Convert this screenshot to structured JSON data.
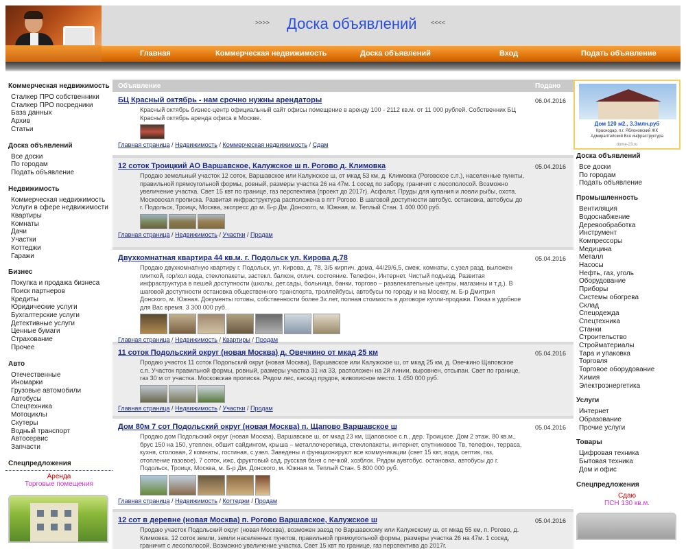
{
  "header": {
    "title": "Доска объявлений",
    "arrows_left": ">>>>",
    "arrows_right": "<<<<"
  },
  "nav": [
    {
      "label": "Главная"
    },
    {
      "label": "Коммерческая недвижимость"
    },
    {
      "label": "Доска объявлений"
    },
    {
      "label": "Вход"
    },
    {
      "label": "Подать объявление"
    }
  ],
  "left": {
    "sections": [
      {
        "title": "Коммерческая недвижимость",
        "items": [
          "Сталкер ПРО собственники",
          "Сталкер ПРО посредники",
          "База данных",
          "Архив",
          "Статьи"
        ]
      },
      {
        "title": "Доска объявлений",
        "items": [
          "Все доски",
          "По городам",
          "Подать объявление"
        ]
      },
      {
        "title": "Недвижимость",
        "items": [
          "Коммерческая недвижимость",
          "Услуги в сфере недвижимости",
          "Квартиры",
          "Комнаты",
          "Дачи",
          "Участки",
          "Коттеджи",
          "Гаражи"
        ]
      },
      {
        "title": "Бизнес",
        "items": [
          "Покупка и продажа бизнеса",
          "Поиск партнеров",
          "Кредиты",
          "Юридические услуги",
          "Бухгалтерские услуги",
          "Детективные услуги",
          "Ценные бумаги",
          "Страхование",
          "Прочее"
        ]
      },
      {
        "title": "Авто",
        "items": [
          "Отечественные",
          "Иномарки",
          "Грузовые автомобили",
          "Автобусы",
          "Спецтехника",
          "Мотоциклы",
          "Скутеры",
          "Водный транспорт",
          "Автосервис",
          "Запчасти"
        ]
      }
    ],
    "special": {
      "title": "Спецпредложения",
      "line1": "Аренда",
      "line2": "Торговые помещения"
    }
  },
  "main": {
    "col_ad": "Объявление",
    "col_date": "Подано",
    "listings": [
      {
        "title": "БЦ Красный октябрь - нам срочно нужны арендаторы",
        "date": "06.04.2016",
        "desc": "Красный октябрь бизнес-центр официальный сайт офисы помещение в аренду 100 - 2112 кв.м. от 11 000 рублей. Собственник БЦ Красный октябрь аренда офиса в Москве.",
        "crumbs": [
          "Главная страница",
          "Недвижимость",
          "Коммерческая недвижимость",
          "Сдам"
        ]
      },
      {
        "title": "12 соток Троицкий АО Варшавское, Калужское ш п. Рогово д. Климовка",
        "date": "05.04.2016",
        "desc": "Продаю земельный участок 12 соток, Варшавское или Калужское ш, от мкад 53 км, д. Климовка (Роговское с.п.), населенные пункты, правильной прямоугольной формы, ровный, размеры участка 26 на 47м. 1 сосед по забору, граничит с лесополосой. Возможно увеличение участка. Свет 15 квт по границе, газ перспектива (проект до 2017г). Асфальт. Пруды для купания и ловли рыбы, охота. Московская прописка. Развитая инфраструктура расположена в пгт Рогово. В шаговой доступности автобус. остановка, автобусы до г. Подольск, Троицк, Москва, экспресс до м. Б-р Дм. Донского, м. Южная, м. Теплый Стан. 1 400 000 руб.",
        "crumbs": [
          "Главная страница",
          "Недвижимость",
          "Участки",
          "Продам"
        ]
      },
      {
        "title": "Двухкомнатная квартира 44 кв.м. г. Подольск ул. Кирова д.78",
        "date": "05.04.2016",
        "desc": "Продаю двухкомнатную квартиру г. Подольск, ул. Кирова, д. 78, 3/5 кирпич. дома, 44/29/6,5, смеж. комнаты, с.узел разд. выложен плиткой, гор/хол вода, стеклопакеты, застекл. балкон, отлич. состояние. Телефон, Интернет. Чистый подъезд. Развитая инфраструктура в пешей доступности (школы, дет.сады, больница, банки, торгово – развлекательные центры, магазины и т.д.). В шаговой доступности остановка общественного транспорта, троллейбусы, автобусы по городу и на Москву, м. Б-р Дмитрия Донского, м. Южная. Документы готовы, собственности более 3х лет, полная стоимость в договоре купли-продажи. Показ в удобное для Вас время. 3 300 000 руб.",
        "crumbs": [
          "Главная страница",
          "Недвижимость",
          "Квартиры",
          "Продам"
        ]
      },
      {
        "title": "11 соток Подольский округ (новая Москва) д. Овечкино от мкад 25 км",
        "date": "05.04.2016",
        "desc": "Продаю участок 11 соток Подольский округ (новая Москва), Варшавское или Калужское ш, от мкад 25 км, д. Овечкино Щаповское с.п. Участок правильной формы, ровный, размеры участка 31 на 33, расположен на 2й линии, выровнен, отсыпан. Свет по границе, газ 30 м от участка. Московская прописка. Рядом лес, каскад прудов, живописное место. 1 450 000 руб.",
        "crumbs": [
          "Главная страница",
          "Недвижимость",
          "Участки",
          "Продам"
        ]
      },
      {
        "title": "Дом 80м 7 сот Подольский округ (новая Москва) п. Щапово Варшавское ш",
        "date": "05.04.2016",
        "desc": "Продаю дом Подольский округ (новая Москва), Варшавское ш, от мкад 23 км, Щаповское с.п., дер. Троицкое. Дом 2 этаж. 80 кв.м., брус 150 на 150, утеплен, обшит сайдингом, крыша – металлочерепица, стеклопакеты, интернет, спутниковое Тв, телефон, терраса, кухня, столовая, 2 комнаты, гостиная, с.узел. Заведены и функционируют все коммуникации (свет 15 квт, вода, септик, газ, отопление газовое). 7 соток, ижс, фруктовый сад, русская баня с печкой, хозблок. Рядом аувтобус. остановка, автобусы до г. Подольск, Троицк, Москва, м. Б-р Дм. Донского, м. Южная м. Теплый Стан. 5 800 000 руб.",
        "crumbs": [
          "Главная страница",
          "Недвижимость",
          "Коттеджи",
          "Продам"
        ]
      },
      {
        "title": "12 сот в деревне (новая Москва) п. Рогово Варшавское, Калужское ш",
        "date": "05.04.2016",
        "desc": "Продаю участок Подольский округ (новая Москва), возможен заезд по Варшавскому или Калужскому ш, от мкад 55 км, п. Рогово, д. Климовка. 12 соток земли, земли населенных пунктов, правильной прямоугольной формы, размеры участка 26 на 47м. 1 сосед, граничит с лесополосой. Возможно увеличение участка. Свет 15 квт по границе, газ перспектива до 2017г.",
        "crumbs": []
      }
    ]
  },
  "right": {
    "ad": {
      "line1": "Дом 120 м2., 3.3млн.руб",
      "line2": "Краснодар, п.г. Яблоновский ЖК",
      "line3": "Адмиралтейский Вся инфраструктура",
      "line4": "dome-23.ru"
    },
    "sections": [
      {
        "title": "Доска объявлений",
        "items": [
          "Все доски",
          "По городам",
          "Подать объявление"
        ]
      },
      {
        "title": "Промышленность",
        "items": [
          "Вентиляция",
          "Водоснабжение",
          "Деревообработка",
          "Инструмент",
          "Компрессоры",
          "Медицина",
          "Металл",
          "Насосы",
          "Нефть, газ, уголь",
          "Оборудование",
          "Приборы",
          "Системы обогрева",
          "Склад",
          "Спецодежда",
          "Спецтехника",
          "Станки",
          "Строительство",
          "Стройматериалы",
          "Тара и упаковка",
          "Торговля",
          "Торговое оборудование",
          "Химия",
          "Электроэнергетика"
        ]
      },
      {
        "title": "Услуги",
        "items": [
          "Интернет",
          "Образование",
          "Прочие услуги"
        ]
      },
      {
        "title": "Товары",
        "items": [
          "Цифровая техника",
          "Бытовая техника",
          "Дом и офис"
        ]
      }
    ],
    "special": {
      "title": "Спецпредложения",
      "line1": "Сдаю",
      "line2": "ПСН 130 кв.м."
    }
  }
}
